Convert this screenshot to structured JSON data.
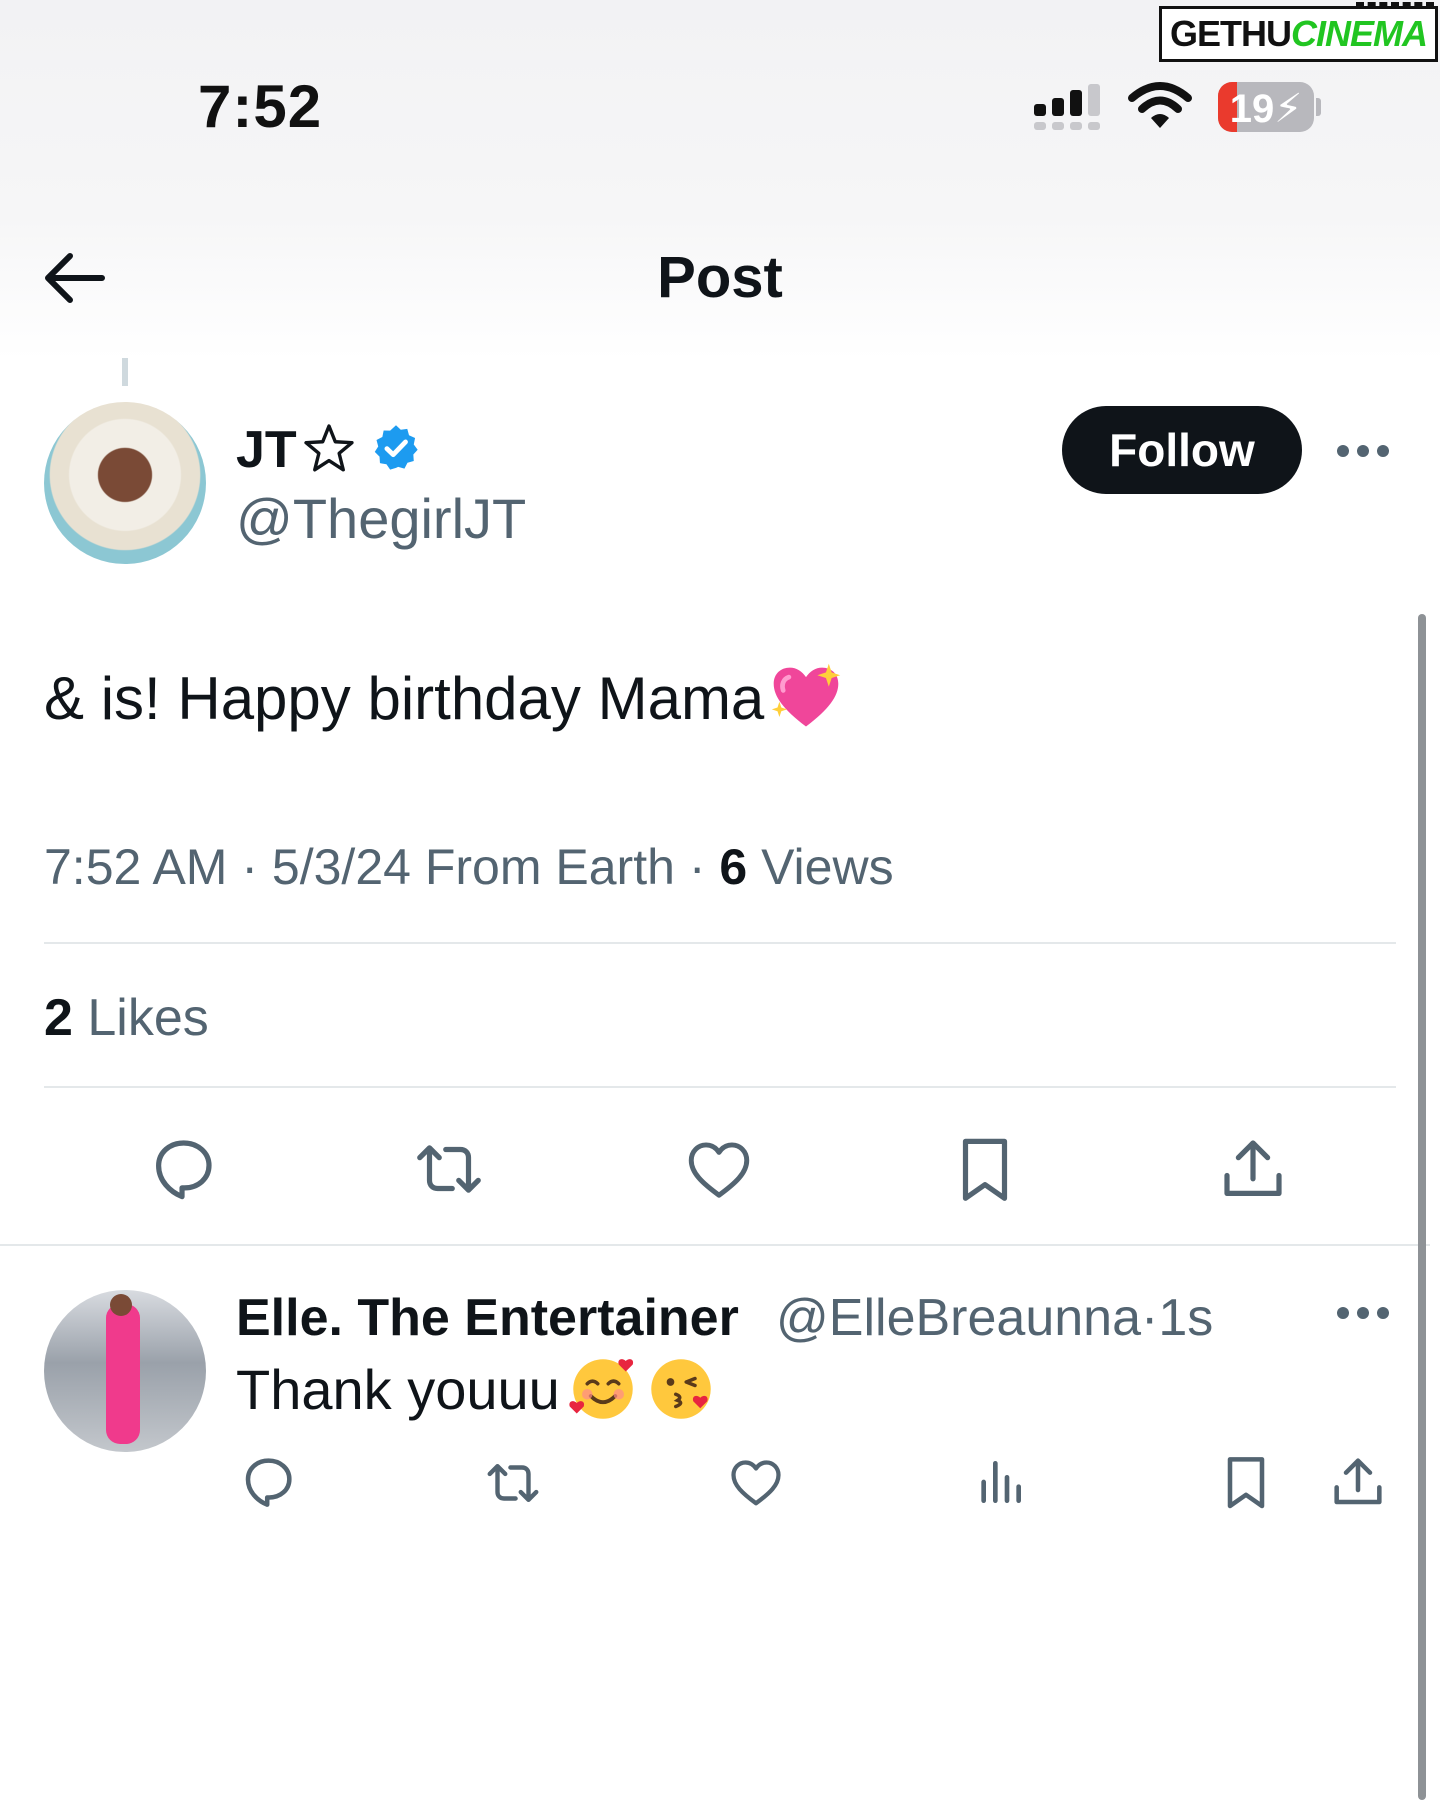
{
  "watermark": {
    "part1": "GETHU",
    "part2": "CINEMA"
  },
  "status_bar": {
    "time": "7:52",
    "battery": "19"
  },
  "nav": {
    "title": "Post"
  },
  "post": {
    "author_name": "JT",
    "author_handle": "@ThegirlJT",
    "follow_label": "Follow",
    "text": "& is! Happy birthday Mama",
    "time": "7:52 AM",
    "date": "5/3/24",
    "source": "From Earth",
    "views_count": "6",
    "views_label": "Views",
    "likes_count": "2",
    "likes_label": "Likes",
    "separator": "·"
  },
  "reply": {
    "author_name": "Elle. The Entertainer",
    "author_handle": "@ElleBreaunna",
    "age": "1s",
    "text": "Thank youuu"
  },
  "colors": {
    "text_primary": "#0f1419",
    "text_secondary": "#536471",
    "verified": "#1d9bf0",
    "follow_bg": "#0f1419",
    "battery_low": "#ea3a2d"
  },
  "icons": {
    "post_actions": [
      "reply-icon",
      "repost-icon",
      "like-icon",
      "bookmark-icon",
      "share-icon"
    ],
    "reply_actions": [
      "reply-icon",
      "repost-icon",
      "like-icon",
      "views-icon",
      "bookmark-icon",
      "share-icon"
    ]
  }
}
